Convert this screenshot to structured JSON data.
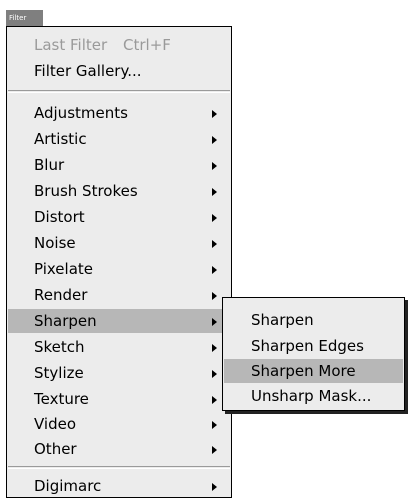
{
  "menubar": {
    "tab_label": "Filter"
  },
  "filter_menu": {
    "last_filter": {
      "label": "Last Filter",
      "shortcut": "Ctrl+F",
      "enabled": false
    },
    "filter_gallery": "Filter Gallery...",
    "groups": [
      "Adjustments",
      "Artistic",
      "Blur",
      "Brush Strokes",
      "Distort",
      "Noise",
      "Pixelate",
      "Render",
      "Sharpen",
      "Sketch",
      "Stylize",
      "Texture",
      "Video",
      "Other"
    ],
    "plugins": [
      "Digimarc"
    ],
    "open_submenu": "Sharpen"
  },
  "sharpen_submenu": {
    "items": [
      "Sharpen",
      "Sharpen Edges",
      "Sharpen More",
      "Unsharp Mask..."
    ],
    "highlighted": "Sharpen More"
  },
  "colors": {
    "menu_background": "#ececec",
    "highlight": "#b7b7b7",
    "disabled_text": "#9a9a9a",
    "tab_background": "#7f7f7f"
  },
  "icons": {
    "submenu_arrow": "submenu-arrow-icon"
  }
}
